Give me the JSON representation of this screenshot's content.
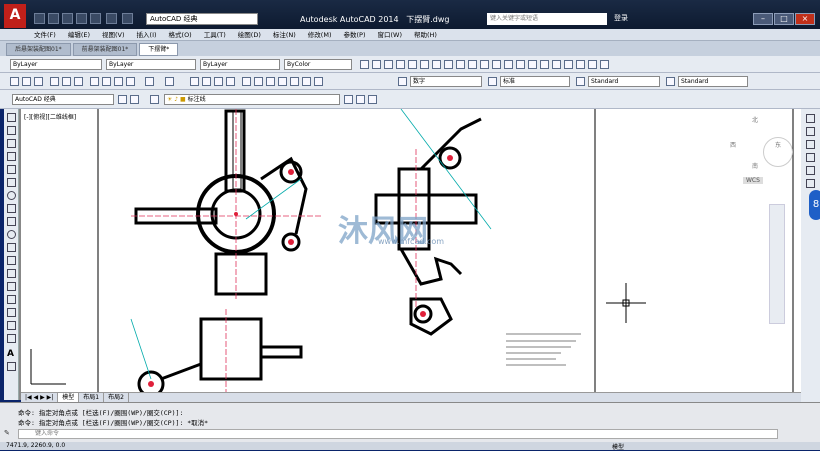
{
  "app": {
    "title": "Autodesk AutoCAD 2014",
    "file": "下摆臂.dwg",
    "workspace": "AutoCAD 经典"
  },
  "search": {
    "placeholder": "键入关键字或短语"
  },
  "login": "登录",
  "menus": [
    "文件(F)",
    "编辑(E)",
    "视图(V)",
    "插入(I)",
    "格式(O)",
    "工具(T)",
    "绘图(D)",
    "标注(N)",
    "修改(M)",
    "参数(P)",
    "窗口(W)",
    "帮助(H)"
  ],
  "doc_tabs": [
    {
      "label": "后悬架装配图01*"
    },
    {
      "label": "前悬架装配图01*"
    },
    {
      "label": "下摆臂*"
    }
  ],
  "toolbar": {
    "layer": "ByLayer",
    "linetype": "ByLayer",
    "lineweight": "ByLayer",
    "color": "ByColor",
    "textstyle": "数字",
    "dimstyle": "标准",
    "tablestyle": "Standard",
    "mleaderstyle": "Standard",
    "workspace2": "AutoCAD 经典",
    "layer_current": "标注线"
  },
  "canvas": {
    "view_label": "[-][俯视][二维线框]"
  },
  "viewcube": {
    "north": "北",
    "west": "西",
    "east": "东",
    "south": "南",
    "wcs": "WCS"
  },
  "watermark": {
    "brand": "沐风网",
    "url": "www.mfcad.com"
  },
  "model_tabs": [
    "模型",
    "布局1",
    "布局2"
  ],
  "command": {
    "line1": "命令: 指定对角点或 [栏选(F)/圈围(WP)/圈交(CP)]:",
    "line2": "命令: 指定对角点或 [栏选(F)/圈围(WP)/圈交(CP)]: *取消*",
    "prompt": "键入命令"
  },
  "status": {
    "coords": "7471.9, 2260.9, 0.0",
    "mode": "模型"
  },
  "colors": {
    "accent": "#c0201a",
    "title_bg": "#0d1a30",
    "canvas": "#ffffff"
  }
}
